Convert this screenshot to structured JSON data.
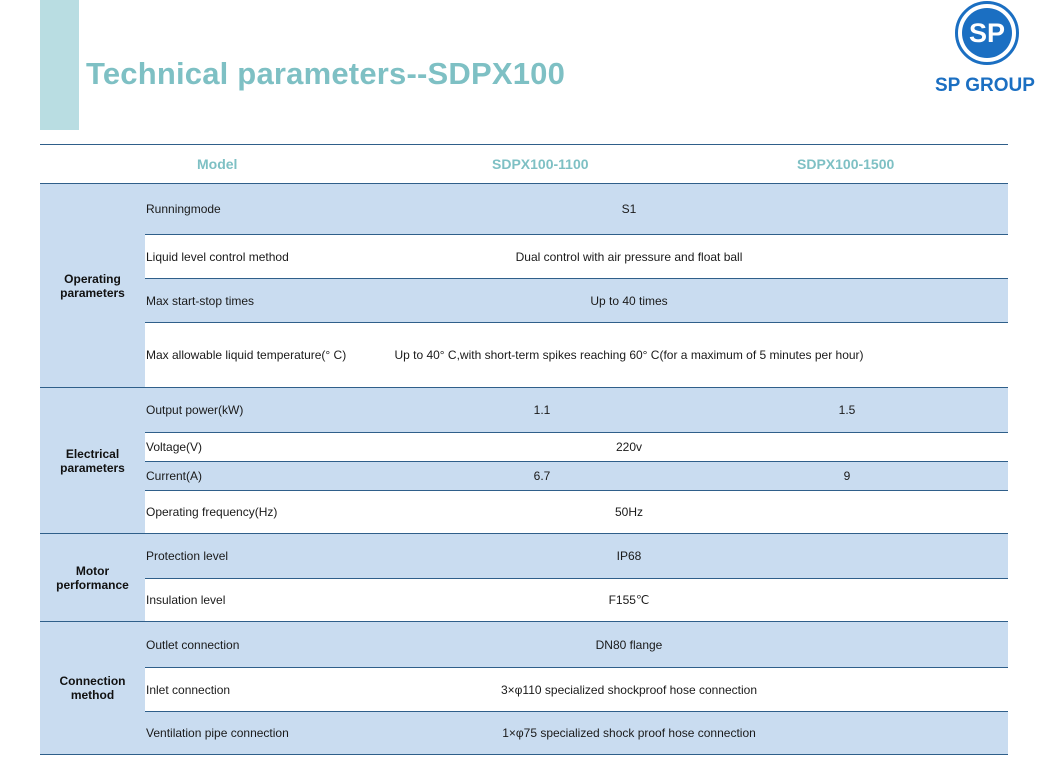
{
  "title": "Technical parameters--SDPX100",
  "logo": {
    "mark": "SP",
    "text": "SP GROUP"
  },
  "table": {
    "headers": {
      "model": "Model",
      "col1": "SDPX100-1100",
      "col2": "SDPX100-1500"
    },
    "groups": [
      {
        "label": "Operating parameters",
        "rows": [
          {
            "param": "Runningmode",
            "value": "S1"
          },
          {
            "param": "Liquid level control method",
            "value": "Dual control with air pressure and float ball"
          },
          {
            "param": "Max start-stop times",
            "value": "Up to 40 times"
          },
          {
            "param": "Max allowable liquid temperature(° C)",
            "value": "Up to 40° C,with short-term spikes reaching 60° C(for a maximum of 5 minutes per hour)"
          }
        ]
      },
      {
        "label": "Electrical parameters",
        "rows": [
          {
            "param": "Output power(kW)",
            "col1": "1.1",
            "col2": "1.5"
          },
          {
            "param": "Voltage(V)",
            "value": "220v"
          },
          {
            "param": "Current(A)",
            "col1": "6.7",
            "col2": "9"
          },
          {
            "param": "Operating frequency(Hz)",
            "value": "50Hz"
          }
        ]
      },
      {
        "label": "Motor performance",
        "rows": [
          {
            "param": "Protection level",
            "value": "IP68"
          },
          {
            "param": "Insulation level",
            "value": "F155℃"
          }
        ]
      },
      {
        "label": "Connection method",
        "rows": [
          {
            "param": "Outlet connection",
            "value": "DN80 flange"
          },
          {
            "param": "Inlet connection",
            "value": "3×φ110 specialized shockproof hose connection"
          },
          {
            "param": "Ventilation pipe connection",
            "value": "1×φ75 specialized shock proof hose connection"
          }
        ]
      }
    ]
  }
}
